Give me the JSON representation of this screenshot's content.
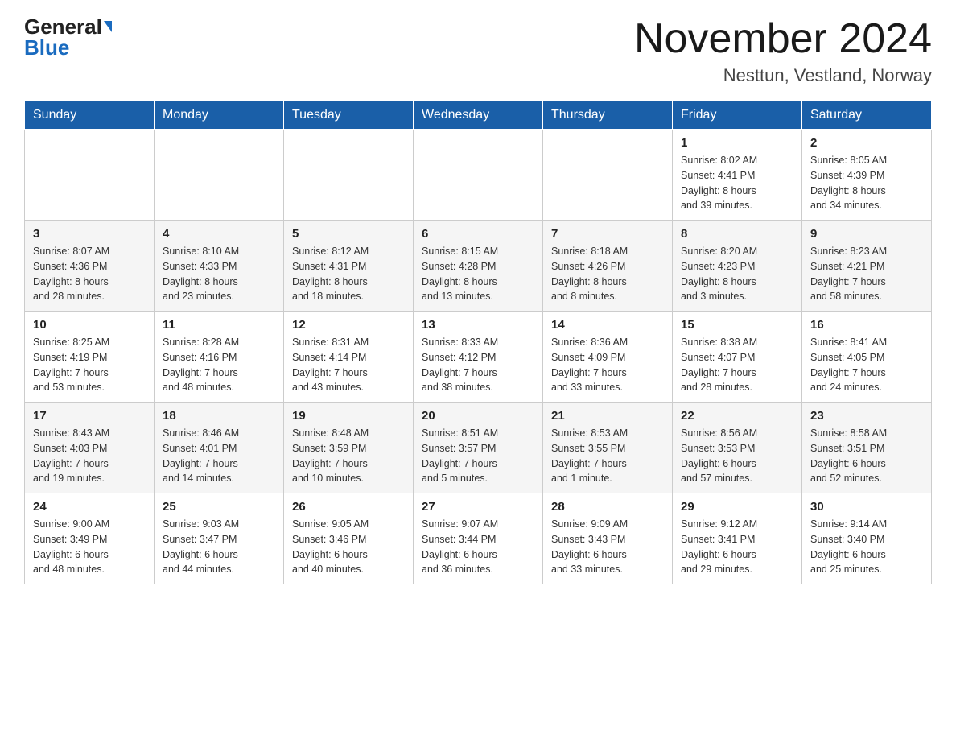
{
  "header": {
    "logo_general": "General",
    "logo_blue": "Blue",
    "month_title": "November 2024",
    "location": "Nesttun, Vestland, Norway"
  },
  "days_of_week": [
    "Sunday",
    "Monday",
    "Tuesday",
    "Wednesday",
    "Thursday",
    "Friday",
    "Saturday"
  ],
  "weeks": [
    [
      {
        "day": "",
        "info": ""
      },
      {
        "day": "",
        "info": ""
      },
      {
        "day": "",
        "info": ""
      },
      {
        "day": "",
        "info": ""
      },
      {
        "day": "",
        "info": ""
      },
      {
        "day": "1",
        "info": "Sunrise: 8:02 AM\nSunset: 4:41 PM\nDaylight: 8 hours\nand 39 minutes."
      },
      {
        "day": "2",
        "info": "Sunrise: 8:05 AM\nSunset: 4:39 PM\nDaylight: 8 hours\nand 34 minutes."
      }
    ],
    [
      {
        "day": "3",
        "info": "Sunrise: 8:07 AM\nSunset: 4:36 PM\nDaylight: 8 hours\nand 28 minutes."
      },
      {
        "day": "4",
        "info": "Sunrise: 8:10 AM\nSunset: 4:33 PM\nDaylight: 8 hours\nand 23 minutes."
      },
      {
        "day": "5",
        "info": "Sunrise: 8:12 AM\nSunset: 4:31 PM\nDaylight: 8 hours\nand 18 minutes."
      },
      {
        "day": "6",
        "info": "Sunrise: 8:15 AM\nSunset: 4:28 PM\nDaylight: 8 hours\nand 13 minutes."
      },
      {
        "day": "7",
        "info": "Sunrise: 8:18 AM\nSunset: 4:26 PM\nDaylight: 8 hours\nand 8 minutes."
      },
      {
        "day": "8",
        "info": "Sunrise: 8:20 AM\nSunset: 4:23 PM\nDaylight: 8 hours\nand 3 minutes."
      },
      {
        "day": "9",
        "info": "Sunrise: 8:23 AM\nSunset: 4:21 PM\nDaylight: 7 hours\nand 58 minutes."
      }
    ],
    [
      {
        "day": "10",
        "info": "Sunrise: 8:25 AM\nSunset: 4:19 PM\nDaylight: 7 hours\nand 53 minutes."
      },
      {
        "day": "11",
        "info": "Sunrise: 8:28 AM\nSunset: 4:16 PM\nDaylight: 7 hours\nand 48 minutes."
      },
      {
        "day": "12",
        "info": "Sunrise: 8:31 AM\nSunset: 4:14 PM\nDaylight: 7 hours\nand 43 minutes."
      },
      {
        "day": "13",
        "info": "Sunrise: 8:33 AM\nSunset: 4:12 PM\nDaylight: 7 hours\nand 38 minutes."
      },
      {
        "day": "14",
        "info": "Sunrise: 8:36 AM\nSunset: 4:09 PM\nDaylight: 7 hours\nand 33 minutes."
      },
      {
        "day": "15",
        "info": "Sunrise: 8:38 AM\nSunset: 4:07 PM\nDaylight: 7 hours\nand 28 minutes."
      },
      {
        "day": "16",
        "info": "Sunrise: 8:41 AM\nSunset: 4:05 PM\nDaylight: 7 hours\nand 24 minutes."
      }
    ],
    [
      {
        "day": "17",
        "info": "Sunrise: 8:43 AM\nSunset: 4:03 PM\nDaylight: 7 hours\nand 19 minutes."
      },
      {
        "day": "18",
        "info": "Sunrise: 8:46 AM\nSunset: 4:01 PM\nDaylight: 7 hours\nand 14 minutes."
      },
      {
        "day": "19",
        "info": "Sunrise: 8:48 AM\nSunset: 3:59 PM\nDaylight: 7 hours\nand 10 minutes."
      },
      {
        "day": "20",
        "info": "Sunrise: 8:51 AM\nSunset: 3:57 PM\nDaylight: 7 hours\nand 5 minutes."
      },
      {
        "day": "21",
        "info": "Sunrise: 8:53 AM\nSunset: 3:55 PM\nDaylight: 7 hours\nand 1 minute."
      },
      {
        "day": "22",
        "info": "Sunrise: 8:56 AM\nSunset: 3:53 PM\nDaylight: 6 hours\nand 57 minutes."
      },
      {
        "day": "23",
        "info": "Sunrise: 8:58 AM\nSunset: 3:51 PM\nDaylight: 6 hours\nand 52 minutes."
      }
    ],
    [
      {
        "day": "24",
        "info": "Sunrise: 9:00 AM\nSunset: 3:49 PM\nDaylight: 6 hours\nand 48 minutes."
      },
      {
        "day": "25",
        "info": "Sunrise: 9:03 AM\nSunset: 3:47 PM\nDaylight: 6 hours\nand 44 minutes."
      },
      {
        "day": "26",
        "info": "Sunrise: 9:05 AM\nSunset: 3:46 PM\nDaylight: 6 hours\nand 40 minutes."
      },
      {
        "day": "27",
        "info": "Sunrise: 9:07 AM\nSunset: 3:44 PM\nDaylight: 6 hours\nand 36 minutes."
      },
      {
        "day": "28",
        "info": "Sunrise: 9:09 AM\nSunset: 3:43 PM\nDaylight: 6 hours\nand 33 minutes."
      },
      {
        "day": "29",
        "info": "Sunrise: 9:12 AM\nSunset: 3:41 PM\nDaylight: 6 hours\nand 29 minutes."
      },
      {
        "day": "30",
        "info": "Sunrise: 9:14 AM\nSunset: 3:40 PM\nDaylight: 6 hours\nand 25 minutes."
      }
    ]
  ]
}
